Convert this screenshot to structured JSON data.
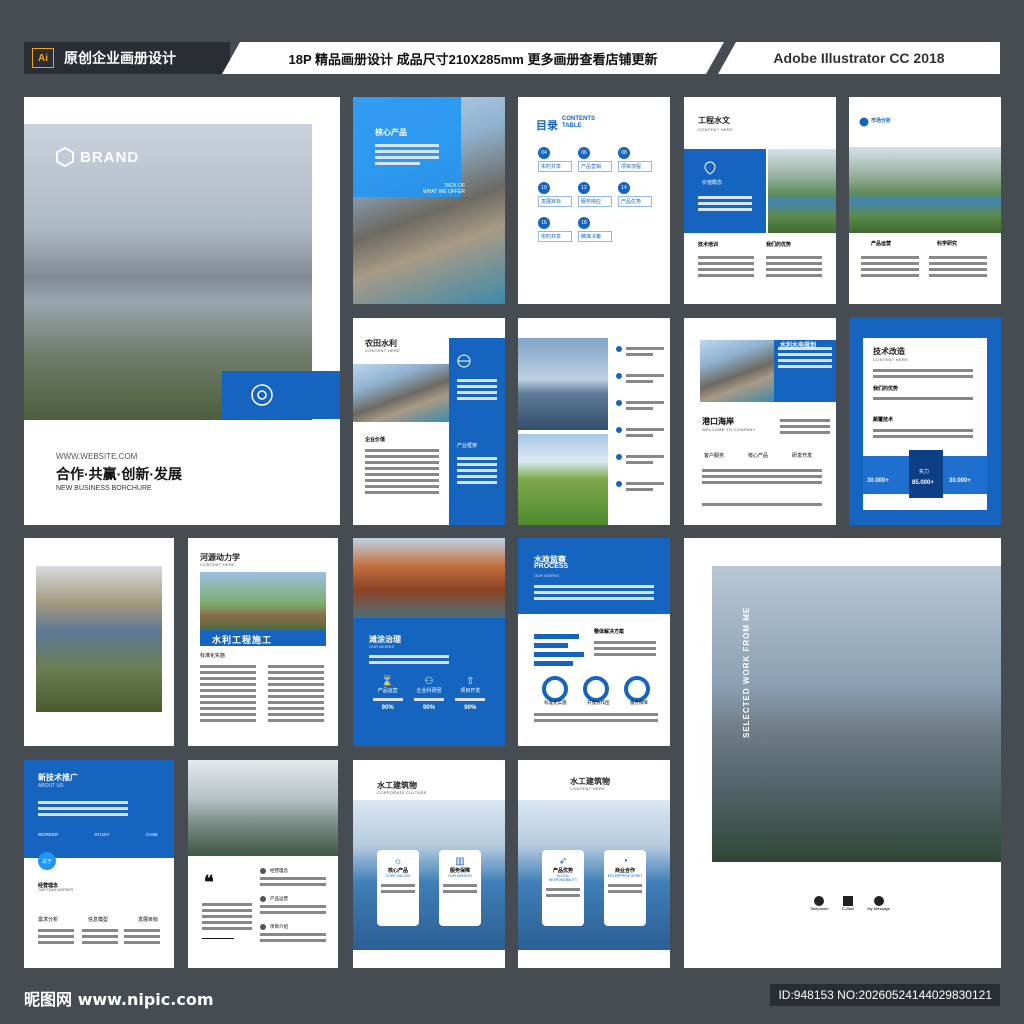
{
  "header": {
    "ai_badge": "Ai",
    "left_title": "原创企业画册设计",
    "middle": "18P 精品画册设计 成品尺寸210X285mm 更多画册查看店铺更新",
    "right": "Adobe Illustrator CC 2018"
  },
  "cover": {
    "brand": "BRAND",
    "website": "WWW.WEBSITE.COM",
    "slogan": "合作·共赢·创新·发展",
    "slogan_en": "NEW BUSINESS BORCHURE"
  },
  "pages": {
    "p2": {
      "title": "核心产品",
      "en1": "TACK OF",
      "en2": "WHAT WE OFFER"
    },
    "p3": {
      "title": "目录",
      "en": "CONTENTS TABLE",
      "items": [
        {
          "num": "04",
          "label": "实时共享"
        },
        {
          "num": "06",
          "label": "产品营销"
        },
        {
          "num": "08",
          "label": "项目流程"
        },
        {
          "num": "10",
          "label": "发展目标"
        },
        {
          "num": "12",
          "label": "服务响应"
        },
        {
          "num": "14",
          "label": "产品优势"
        },
        {
          "num": "16",
          "label": "实时共享"
        },
        {
          "num": "18",
          "label": "精准决策"
        }
      ]
    },
    "p4": {
      "title": "工程水文",
      "en": "CONTENT HERE",
      "label1": "价值概念",
      "label2": "技术培训",
      "label3": "我们的优势"
    },
    "p5": {
      "title": "市场分析",
      "label1": "产品运营",
      "label2": "科学研究"
    },
    "p6": {
      "title": "农田水利",
      "en": "CONTENT HERE",
      "label1": "企业价值",
      "label2": "产业框架"
    },
    "p8": {
      "title": "水利水电规划",
      "en": "CREATIVE / DESIGN",
      "title2": "港口海岸",
      "en2": "WELCOME TO COMPANY",
      "i1": "客户服务",
      "i2": "核心产品",
      "i3": "研发开发"
    },
    "p9": {
      "title": "技术改造",
      "en": "CONTENT HERE",
      "l1": "我们的优势",
      "l2": "颠覆技术",
      "n1": "30.000+",
      "n2": "实力",
      "n3": "85.000+",
      "n4": "30.000+"
    },
    "p11": {
      "title": "河源动力学",
      "en": "CONTENT HERE",
      "banner": "水利工程施工",
      "label": "标准化实施"
    },
    "p12": {
      "title": "滩涂治理",
      "en": "OUR WORKS",
      "i1": "产品运营",
      "i2": "企业科研团",
      "i3": "项目开发",
      "v1": "90%",
      "v2": "90%",
      "v3": "90%"
    },
    "p13": {
      "title": "水政监察",
      "en": "PROCESS",
      "en2": "OUR WORKS",
      "label": "整体解决方案",
      "i1": "标准化实施",
      "i2": "开放协作团",
      "i3": "服务保障"
    },
    "p15": {
      "title": "新技术推广",
      "en": "ABOUT US",
      "t1": "WORKER",
      "t2": "STUDY",
      "t3": "CASE",
      "badge": "关于",
      "l1": "经营理念",
      "l1en": "OUR TEAM WORKER",
      "c1": "需求分析",
      "c2": "信息模型",
      "c3": "发展目标"
    },
    "p16": {
      "i1": "经营理念",
      "i2": "产品运营",
      "i3": "项目介绍"
    },
    "p17": {
      "title": "水工建筑物",
      "en": "CORPORATE CULTURE",
      "c1": "核心产品",
      "c1en": "CORE VALUES",
      "c2": "服务保障",
      "c2en": "OUR MISSION"
    },
    "p18": {
      "title": "水工建筑物",
      "en": "CONTENT HERE",
      "c1": "产品优势",
      "c1en": "SOCIAL RESPONSIBILITY",
      "c2": "商业合作",
      "c2en": "ENTERPRISE SPIRIT"
    },
    "back": {
      "vertical": "SELECTED WORK FROM ME",
      "f1": "Telephone",
      "f2": "E-Mail",
      "f3": "My Message"
    }
  },
  "footer": {
    "logo": "昵图网 www.nipic.com",
    "id": "ID:948153 NO:20260524144029830121"
  },
  "colors": {
    "accent": "#1565c0",
    "accent_light": "#2196f3",
    "background": "#474b52"
  }
}
